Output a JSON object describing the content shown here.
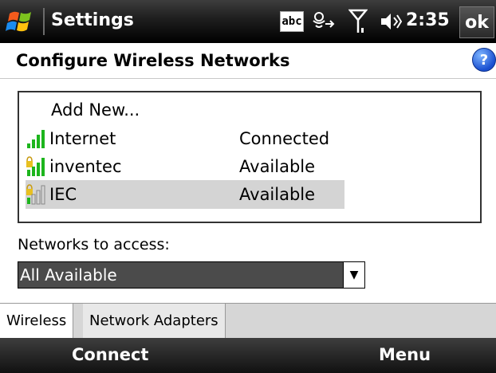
{
  "titlebar": {
    "title": "Settings",
    "abc_label": "abc",
    "time": "2:35",
    "ok_label": "ok"
  },
  "header": {
    "title": "Configure Wireless Networks",
    "help_label": "?"
  },
  "networks": {
    "add_new": "Add New...",
    "rows": [
      {
        "name": "Internet",
        "status": "Connected",
        "secured": false,
        "signal_bars": 4,
        "selected": false
      },
      {
        "name": "inventec",
        "status": "Available",
        "secured": true,
        "signal_bars": 4,
        "selected": false
      },
      {
        "name": "IEC",
        "status": "Available",
        "secured": true,
        "signal_bars": 1,
        "selected": true
      }
    ]
  },
  "access": {
    "label": "Networks to access:",
    "selected": "All Available"
  },
  "tabs": [
    {
      "label": "Wireless",
      "active": true
    },
    {
      "label": "Network Adapters",
      "active": false
    }
  ],
  "softkeys": {
    "left": "Connect",
    "right": "Menu"
  },
  "colors": {
    "signal_green": "#1db51d",
    "lock_yellow": "#e8c020",
    "selection": "#d4d4d4"
  }
}
